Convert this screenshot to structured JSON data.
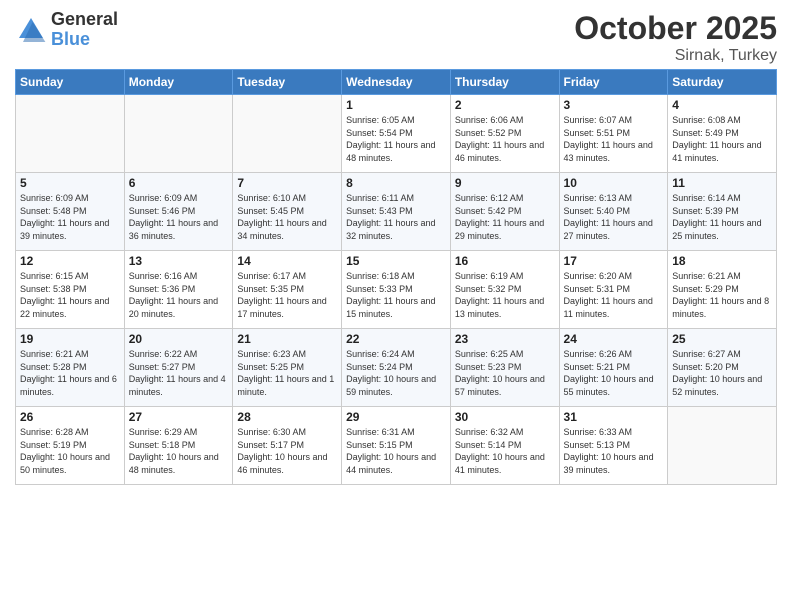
{
  "header": {
    "logo_general": "General",
    "logo_blue": "Blue",
    "month": "October 2025",
    "location": "Sirnak, Turkey"
  },
  "weekdays": [
    "Sunday",
    "Monday",
    "Tuesday",
    "Wednesday",
    "Thursday",
    "Friday",
    "Saturday"
  ],
  "weeks": [
    [
      {
        "day": "",
        "sunrise": "",
        "sunset": "",
        "daylight": ""
      },
      {
        "day": "",
        "sunrise": "",
        "sunset": "",
        "daylight": ""
      },
      {
        "day": "",
        "sunrise": "",
        "sunset": "",
        "daylight": ""
      },
      {
        "day": "1",
        "sunrise": "Sunrise: 6:05 AM",
        "sunset": "Sunset: 5:54 PM",
        "daylight": "Daylight: 11 hours and 48 minutes."
      },
      {
        "day": "2",
        "sunrise": "Sunrise: 6:06 AM",
        "sunset": "Sunset: 5:52 PM",
        "daylight": "Daylight: 11 hours and 46 minutes."
      },
      {
        "day": "3",
        "sunrise": "Sunrise: 6:07 AM",
        "sunset": "Sunset: 5:51 PM",
        "daylight": "Daylight: 11 hours and 43 minutes."
      },
      {
        "day": "4",
        "sunrise": "Sunrise: 6:08 AM",
        "sunset": "Sunset: 5:49 PM",
        "daylight": "Daylight: 11 hours and 41 minutes."
      }
    ],
    [
      {
        "day": "5",
        "sunrise": "Sunrise: 6:09 AM",
        "sunset": "Sunset: 5:48 PM",
        "daylight": "Daylight: 11 hours and 39 minutes."
      },
      {
        "day": "6",
        "sunrise": "Sunrise: 6:09 AM",
        "sunset": "Sunset: 5:46 PM",
        "daylight": "Daylight: 11 hours and 36 minutes."
      },
      {
        "day": "7",
        "sunrise": "Sunrise: 6:10 AM",
        "sunset": "Sunset: 5:45 PM",
        "daylight": "Daylight: 11 hours and 34 minutes."
      },
      {
        "day": "8",
        "sunrise": "Sunrise: 6:11 AM",
        "sunset": "Sunset: 5:43 PM",
        "daylight": "Daylight: 11 hours and 32 minutes."
      },
      {
        "day": "9",
        "sunrise": "Sunrise: 6:12 AM",
        "sunset": "Sunset: 5:42 PM",
        "daylight": "Daylight: 11 hours and 29 minutes."
      },
      {
        "day": "10",
        "sunrise": "Sunrise: 6:13 AM",
        "sunset": "Sunset: 5:40 PM",
        "daylight": "Daylight: 11 hours and 27 minutes."
      },
      {
        "day": "11",
        "sunrise": "Sunrise: 6:14 AM",
        "sunset": "Sunset: 5:39 PM",
        "daylight": "Daylight: 11 hours and 25 minutes."
      }
    ],
    [
      {
        "day": "12",
        "sunrise": "Sunrise: 6:15 AM",
        "sunset": "Sunset: 5:38 PM",
        "daylight": "Daylight: 11 hours and 22 minutes."
      },
      {
        "day": "13",
        "sunrise": "Sunrise: 6:16 AM",
        "sunset": "Sunset: 5:36 PM",
        "daylight": "Daylight: 11 hours and 20 minutes."
      },
      {
        "day": "14",
        "sunrise": "Sunrise: 6:17 AM",
        "sunset": "Sunset: 5:35 PM",
        "daylight": "Daylight: 11 hours and 17 minutes."
      },
      {
        "day": "15",
        "sunrise": "Sunrise: 6:18 AM",
        "sunset": "Sunset: 5:33 PM",
        "daylight": "Daylight: 11 hours and 15 minutes."
      },
      {
        "day": "16",
        "sunrise": "Sunrise: 6:19 AM",
        "sunset": "Sunset: 5:32 PM",
        "daylight": "Daylight: 11 hours and 13 minutes."
      },
      {
        "day": "17",
        "sunrise": "Sunrise: 6:20 AM",
        "sunset": "Sunset: 5:31 PM",
        "daylight": "Daylight: 11 hours and 11 minutes."
      },
      {
        "day": "18",
        "sunrise": "Sunrise: 6:21 AM",
        "sunset": "Sunset: 5:29 PM",
        "daylight": "Daylight: 11 hours and 8 minutes."
      }
    ],
    [
      {
        "day": "19",
        "sunrise": "Sunrise: 6:21 AM",
        "sunset": "Sunset: 5:28 PM",
        "daylight": "Daylight: 11 hours and 6 minutes."
      },
      {
        "day": "20",
        "sunrise": "Sunrise: 6:22 AM",
        "sunset": "Sunset: 5:27 PM",
        "daylight": "Daylight: 11 hours and 4 minutes."
      },
      {
        "day": "21",
        "sunrise": "Sunrise: 6:23 AM",
        "sunset": "Sunset: 5:25 PM",
        "daylight": "Daylight: 11 hours and 1 minute."
      },
      {
        "day": "22",
        "sunrise": "Sunrise: 6:24 AM",
        "sunset": "Sunset: 5:24 PM",
        "daylight": "Daylight: 10 hours and 59 minutes."
      },
      {
        "day": "23",
        "sunrise": "Sunrise: 6:25 AM",
        "sunset": "Sunset: 5:23 PM",
        "daylight": "Daylight: 10 hours and 57 minutes."
      },
      {
        "day": "24",
        "sunrise": "Sunrise: 6:26 AM",
        "sunset": "Sunset: 5:21 PM",
        "daylight": "Daylight: 10 hours and 55 minutes."
      },
      {
        "day": "25",
        "sunrise": "Sunrise: 6:27 AM",
        "sunset": "Sunset: 5:20 PM",
        "daylight": "Daylight: 10 hours and 52 minutes."
      }
    ],
    [
      {
        "day": "26",
        "sunrise": "Sunrise: 6:28 AM",
        "sunset": "Sunset: 5:19 PM",
        "daylight": "Daylight: 10 hours and 50 minutes."
      },
      {
        "day": "27",
        "sunrise": "Sunrise: 6:29 AM",
        "sunset": "Sunset: 5:18 PM",
        "daylight": "Daylight: 10 hours and 48 minutes."
      },
      {
        "day": "28",
        "sunrise": "Sunrise: 6:30 AM",
        "sunset": "Sunset: 5:17 PM",
        "daylight": "Daylight: 10 hours and 46 minutes."
      },
      {
        "day": "29",
        "sunrise": "Sunrise: 6:31 AM",
        "sunset": "Sunset: 5:15 PM",
        "daylight": "Daylight: 10 hours and 44 minutes."
      },
      {
        "day": "30",
        "sunrise": "Sunrise: 6:32 AM",
        "sunset": "Sunset: 5:14 PM",
        "daylight": "Daylight: 10 hours and 41 minutes."
      },
      {
        "day": "31",
        "sunrise": "Sunrise: 6:33 AM",
        "sunset": "Sunset: 5:13 PM",
        "daylight": "Daylight: 10 hours and 39 minutes."
      },
      {
        "day": "",
        "sunrise": "",
        "sunset": "",
        "daylight": ""
      }
    ]
  ]
}
